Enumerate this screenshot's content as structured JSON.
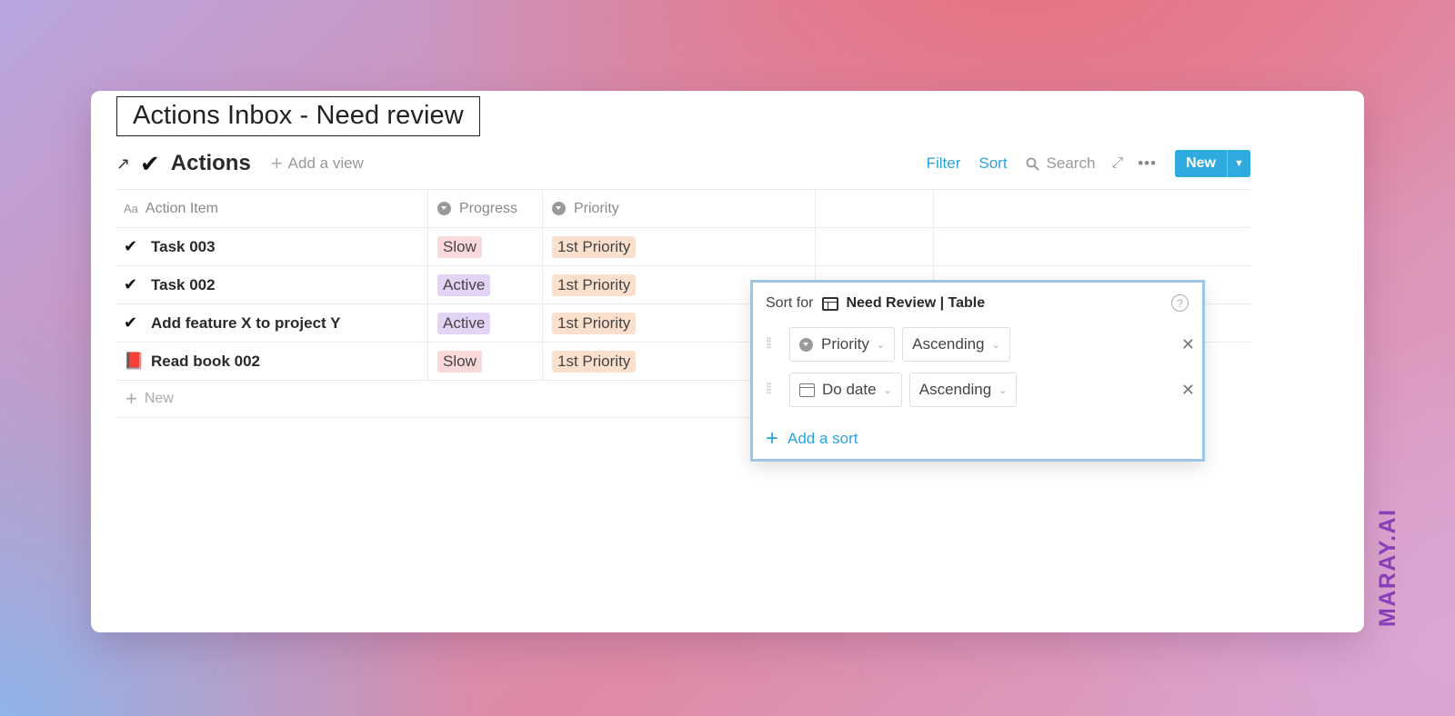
{
  "page_title": "Actions Inbox - Need review",
  "toolbar": {
    "link_icon": "↗",
    "db_icon": "✔",
    "db_name": "Actions",
    "add_view": "Add a view",
    "filter": "Filter",
    "sort": "Sort",
    "search": "Search",
    "new_label": "New"
  },
  "table": {
    "headers": [
      "Action Item",
      "Progress",
      "Priority"
    ],
    "rows": [
      {
        "icon": "✔",
        "title": "Task 003",
        "progress": "Slow",
        "priority": "1st Priority"
      },
      {
        "icon": "✔",
        "title": "Task 002",
        "progress": "Active",
        "priority": "1st Priority"
      },
      {
        "icon": "✔",
        "title": "Add feature X to project Y",
        "progress": "Active",
        "priority": "1st Priority"
      },
      {
        "icon": "📕",
        "title": "Read book 002",
        "progress": "Slow",
        "priority": "1st Priority"
      }
    ],
    "new_row_label": "New"
  },
  "sort_popup": {
    "prefix": "Sort for",
    "view_name": "Need Review | Table",
    "rules": [
      {
        "property": "Priority",
        "direction": "Ascending"
      },
      {
        "property": "Do date",
        "direction": "Ascending"
      }
    ],
    "add_sort": "Add a sort"
  },
  "watermark": "MARAY.AI",
  "colors": {
    "accent": "#2eaadc",
    "tag_slow": "#fbd9d9",
    "tag_active": "#e3d3f5",
    "tag_priority": "#fbe0cd",
    "watermark": "#8a3fb8"
  }
}
